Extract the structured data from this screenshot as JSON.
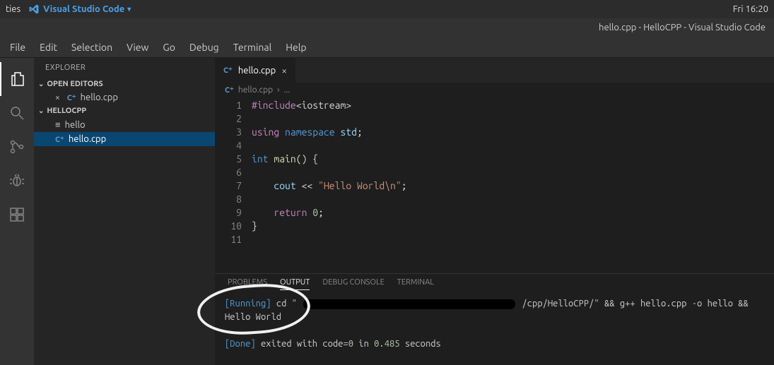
{
  "system_bar": {
    "activities_label": "ties",
    "vscode_label": "Visual Studio Code",
    "clock": "Fri 16:20"
  },
  "title_bar": "hello.cpp - HelloCPP - Visual Studio Code",
  "menu": [
    "File",
    "Edit",
    "Selection",
    "View",
    "Go",
    "Debug",
    "Terminal",
    "Help"
  ],
  "sidebar": {
    "title": "EXPLORER",
    "open_editors_label": "OPEN EDITORS",
    "open_editors": [
      {
        "name": "hello.cpp",
        "icon": "cpp"
      }
    ],
    "folder_label": "HELLOCPP",
    "files": [
      {
        "name": "hello",
        "icon": "generic"
      },
      {
        "name": "hello.cpp",
        "icon": "cpp",
        "selected": true
      }
    ]
  },
  "tabs": [
    {
      "name": "hello.cpp",
      "icon": "cpp"
    }
  ],
  "breadcrumb": {
    "file": "hello.cpp",
    "sep": "›",
    "rest": "..."
  },
  "code": {
    "lines": [
      {
        "n": 1,
        "tokens": [
          [
            "kw",
            "#include"
          ],
          [
            "pl",
            "<iostream>"
          ]
        ]
      },
      {
        "n": 2,
        "tokens": []
      },
      {
        "n": 3,
        "tokens": [
          [
            "kw",
            "using"
          ],
          [
            "sp",
            " "
          ],
          [
            "kw2",
            "namespace"
          ],
          [
            "sp",
            " "
          ],
          [
            "var",
            "std"
          ],
          [
            "pl",
            ";"
          ]
        ]
      },
      {
        "n": 4,
        "tokens": []
      },
      {
        "n": 5,
        "tokens": [
          [
            "type",
            "int"
          ],
          [
            "sp",
            " "
          ],
          [
            "fn",
            "main"
          ],
          [
            "pl",
            "() {"
          ]
        ]
      },
      {
        "n": 6,
        "tokens": []
      },
      {
        "n": 7,
        "tokens": [
          [
            "sp",
            "    "
          ],
          [
            "var",
            "cout"
          ],
          [
            "pl",
            " << "
          ],
          [
            "str",
            "\"Hello World\\n\""
          ],
          [
            "pl",
            ";"
          ]
        ]
      },
      {
        "n": 8,
        "tokens": []
      },
      {
        "n": 9,
        "tokens": [
          [
            "sp",
            "    "
          ],
          [
            "kw",
            "return"
          ],
          [
            "sp",
            " "
          ],
          [
            "num",
            "0"
          ],
          [
            "pl",
            ";"
          ]
        ]
      },
      {
        "n": 10,
        "tokens": [
          [
            "pl",
            "}"
          ]
        ]
      },
      {
        "n": 11,
        "tokens": []
      }
    ]
  },
  "panel": {
    "tabs": [
      "PROBLEMS",
      "OUTPUT",
      "DEBUG CONSOLE",
      "TERMINAL"
    ],
    "active_tab": "OUTPUT",
    "output": {
      "running_tag": "[Running]",
      "cmd_prefix": "cd \"",
      "cmd_suffix": "/cpp/HelloCPP/\" && g++ hello.cpp -o hello &&",
      "program_output": "Hello World",
      "done_tag": "[Done]",
      "exit_prefix": "exited with code=",
      "exit_code": "0",
      "in_word": " in ",
      "time": "0.485",
      "seconds_word": " seconds"
    }
  }
}
